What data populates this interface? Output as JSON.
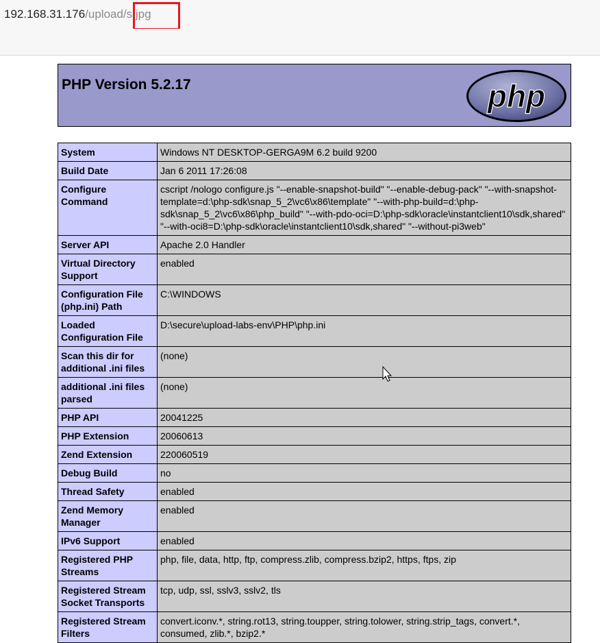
{
  "browser": {
    "url_host": "192.168.31.176",
    "url_path_prefix": "/upload",
    "url_path_file": "/s.jpg"
  },
  "page": {
    "title": "PHP Version 5.2.17",
    "logo_text": "php",
    "colors": {
      "header_bg": "#9999cc",
      "key_bg": "#ccccff",
      "value_bg": "#cccccc",
      "highlight": "#e8161d"
    }
  },
  "rows": [
    {
      "key": "System",
      "value": "Windows NT DESKTOP-GERGA9M 6.2 build 9200"
    },
    {
      "key": "Build Date",
      "value": "Jan 6 2011 17:26:08"
    },
    {
      "key": "Configure Command",
      "value": "cscript /nologo configure.js \"--enable-snapshot-build\" \"--enable-debug-pack\" \"--with-snapshot-template=d:\\php-sdk\\snap_5_2\\vc6\\x86\\template\" \"--with-php-build=d:\\php-sdk\\snap_5_2\\vc6\\x86\\php_build\" \"--with-pdo-oci=D:\\php-sdk\\oracle\\instantclient10\\sdk,shared\" \"--with-oci8=D:\\php-sdk\\oracle\\instantclient10\\sdk,shared\" \"--without-pi3web\""
    },
    {
      "key": "Server API",
      "value": "Apache 2.0 Handler"
    },
    {
      "key": "Virtual Directory Support",
      "value": "enabled"
    },
    {
      "key": "Configuration File (php.ini) Path",
      "value": "C:\\WINDOWS"
    },
    {
      "key": "Loaded Configuration File",
      "value": "D:\\secure\\upload-labs-env\\PHP\\php.ini"
    },
    {
      "key": "Scan this dir for additional .ini files",
      "value": "(none)"
    },
    {
      "key": "additional .ini files parsed",
      "value": "(none)"
    },
    {
      "key": "PHP API",
      "value": "20041225"
    },
    {
      "key": "PHP Extension",
      "value": "20060613"
    },
    {
      "key": "Zend Extension",
      "value": "220060519"
    },
    {
      "key": "Debug Build",
      "value": "no"
    },
    {
      "key": "Thread Safety",
      "value": "enabled"
    },
    {
      "key": "Zend Memory Manager",
      "value": "enabled"
    },
    {
      "key": "IPv6 Support",
      "value": "enabled"
    },
    {
      "key": "Registered PHP Streams",
      "value": "php, file, data, http, ftp, compress.zlib, compress.bzip2, https, ftps, zip"
    },
    {
      "key": "Registered Stream Socket Transports",
      "value": "tcp, udp, ssl, sslv3, sslv2, tls"
    },
    {
      "key": "Registered Stream Filters",
      "value": "convert.iconv.*, string.rot13, string.toupper, string.tolower, string.strip_tags, convert.*, consumed, zlib.*, bzip2.*"
    }
  ]
}
